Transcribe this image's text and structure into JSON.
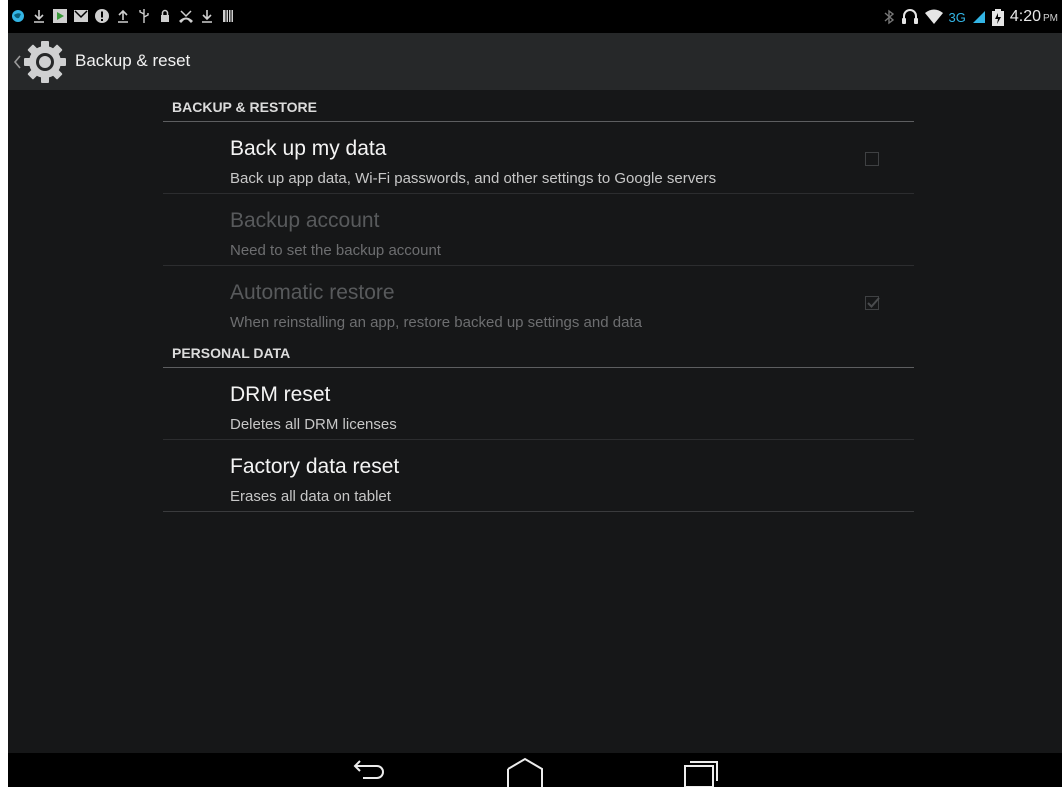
{
  "status_bar": {
    "left_icons": [
      "globe-icon",
      "download-icon",
      "play-store-icon",
      "gmail-icon",
      "alert-icon",
      "upload-icon",
      "usb-icon",
      "lock-icon",
      "missed-call-icon",
      "download-icon",
      "sd-card-icon"
    ],
    "network_label": "3G",
    "time": "4:20",
    "ampm": "PM",
    "accent_color": "#33b5e5"
  },
  "action_bar": {
    "title": "Backup & reset",
    "icon": "settings-gear-icon"
  },
  "sections": [
    {
      "header": "BACKUP & RESTORE",
      "items": [
        {
          "title": "Back up my data",
          "summary": "Back up app data, Wi-Fi passwords, and other settings to Google servers",
          "enabled": true,
          "checkbox": "unchecked"
        },
        {
          "title": "Backup account",
          "summary": "Need to set the backup account",
          "enabled": false,
          "checkbox": "none"
        },
        {
          "title": "Automatic restore",
          "summary": "When reinstalling an app, restore backed up settings and data",
          "enabled": false,
          "checkbox": "checked"
        }
      ]
    },
    {
      "header": "PERSONAL DATA",
      "items": [
        {
          "title": "DRM reset",
          "summary": "Deletes all DRM licenses",
          "enabled": true,
          "checkbox": "none"
        },
        {
          "title": "Factory data reset",
          "summary": "Erases all data on tablet",
          "enabled": true,
          "checkbox": "none"
        }
      ]
    }
  ],
  "nav_bar": {
    "buttons": [
      "back-icon",
      "home-icon",
      "recent-apps-icon"
    ]
  }
}
